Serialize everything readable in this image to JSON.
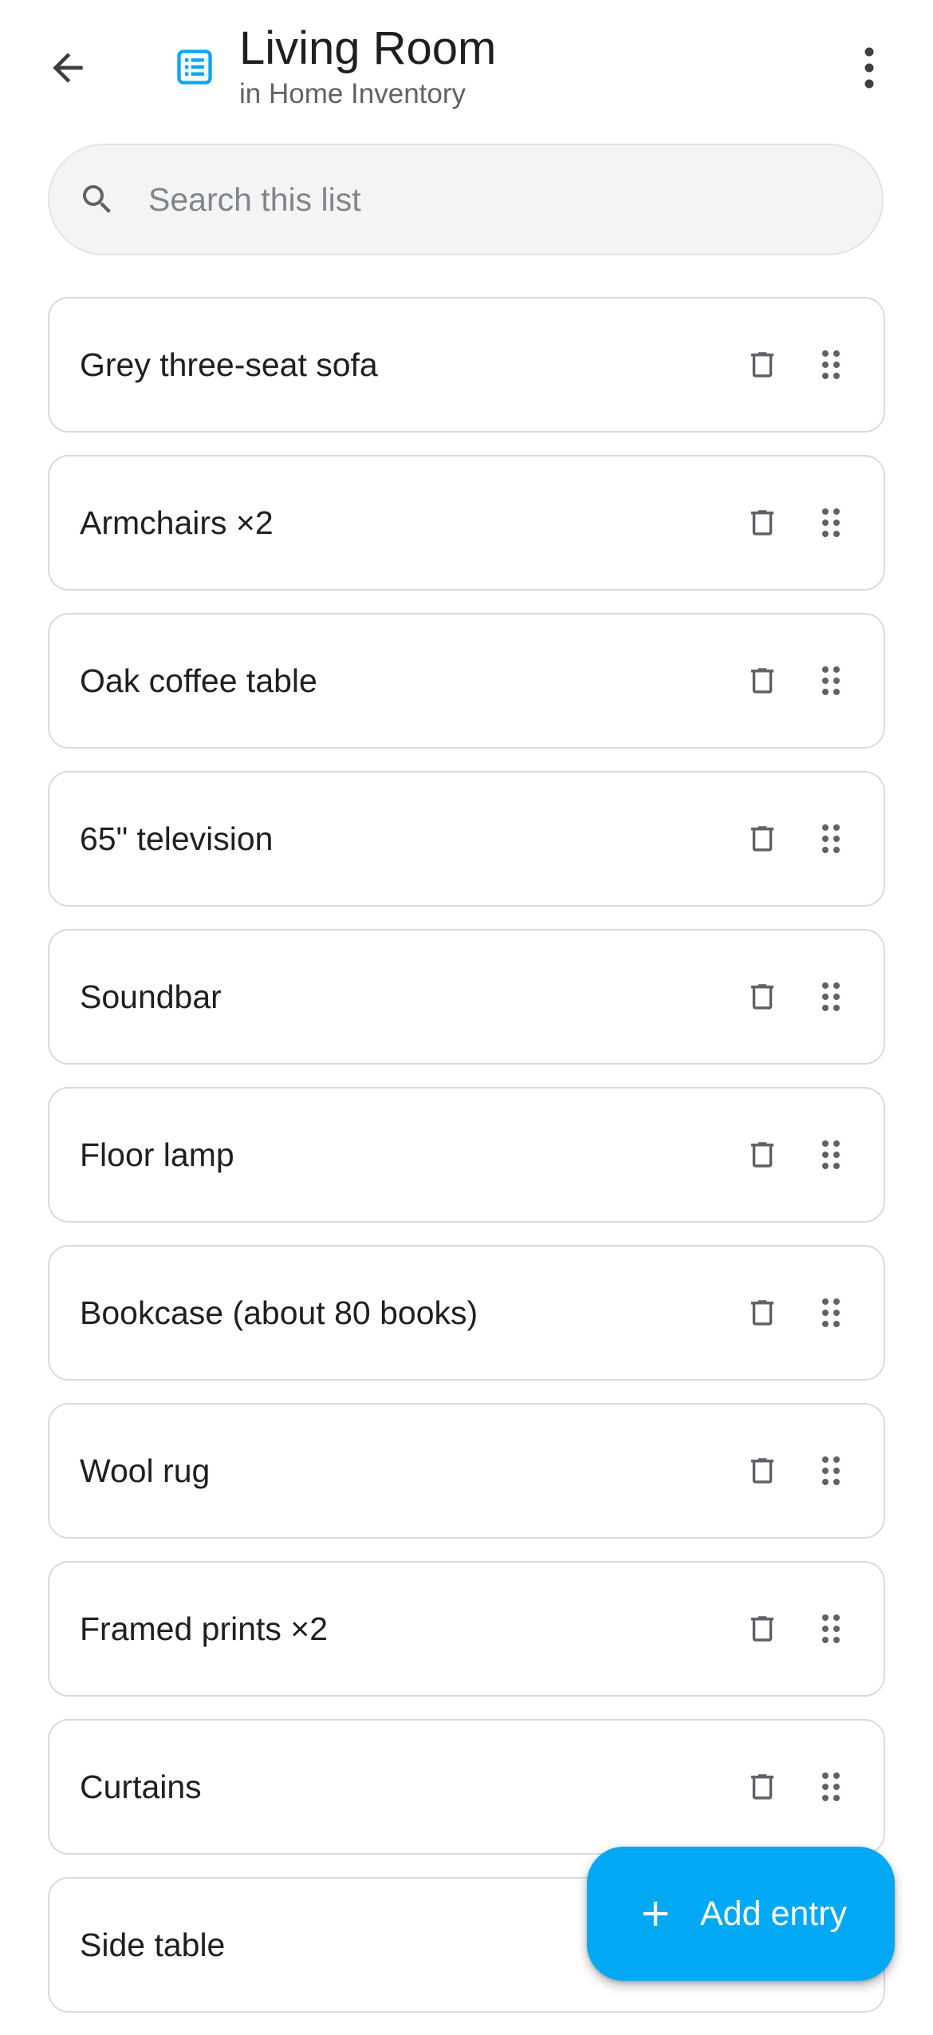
{
  "header": {
    "title": "Living Room",
    "subtitle": "in Home Inventory",
    "back_icon": "arrow-left-icon",
    "list_icon": "list-icon",
    "menu_icon": "more-vertical-icon"
  },
  "search": {
    "placeholder": "Search this list",
    "value": "",
    "icon": "search-icon"
  },
  "items": [
    {
      "label": "Grey three-seat sofa"
    },
    {
      "label": "Armchairs ×2"
    },
    {
      "label": "Oak coffee table"
    },
    {
      "label": "65\" television"
    },
    {
      "label": "Soundbar"
    },
    {
      "label": "Floor lamp"
    },
    {
      "label": "Bookcase (about 80 books)"
    },
    {
      "label": "Wool rug"
    },
    {
      "label": "Framed prints ×2"
    },
    {
      "label": "Curtains"
    },
    {
      "label": "Side table"
    }
  ],
  "fab": {
    "label": "Add entry",
    "icon": "plus-icon"
  },
  "colors": {
    "accent": "#03a9f4",
    "text": "#1f1f1f",
    "muted": "#5f6368",
    "border": "#dadada"
  }
}
